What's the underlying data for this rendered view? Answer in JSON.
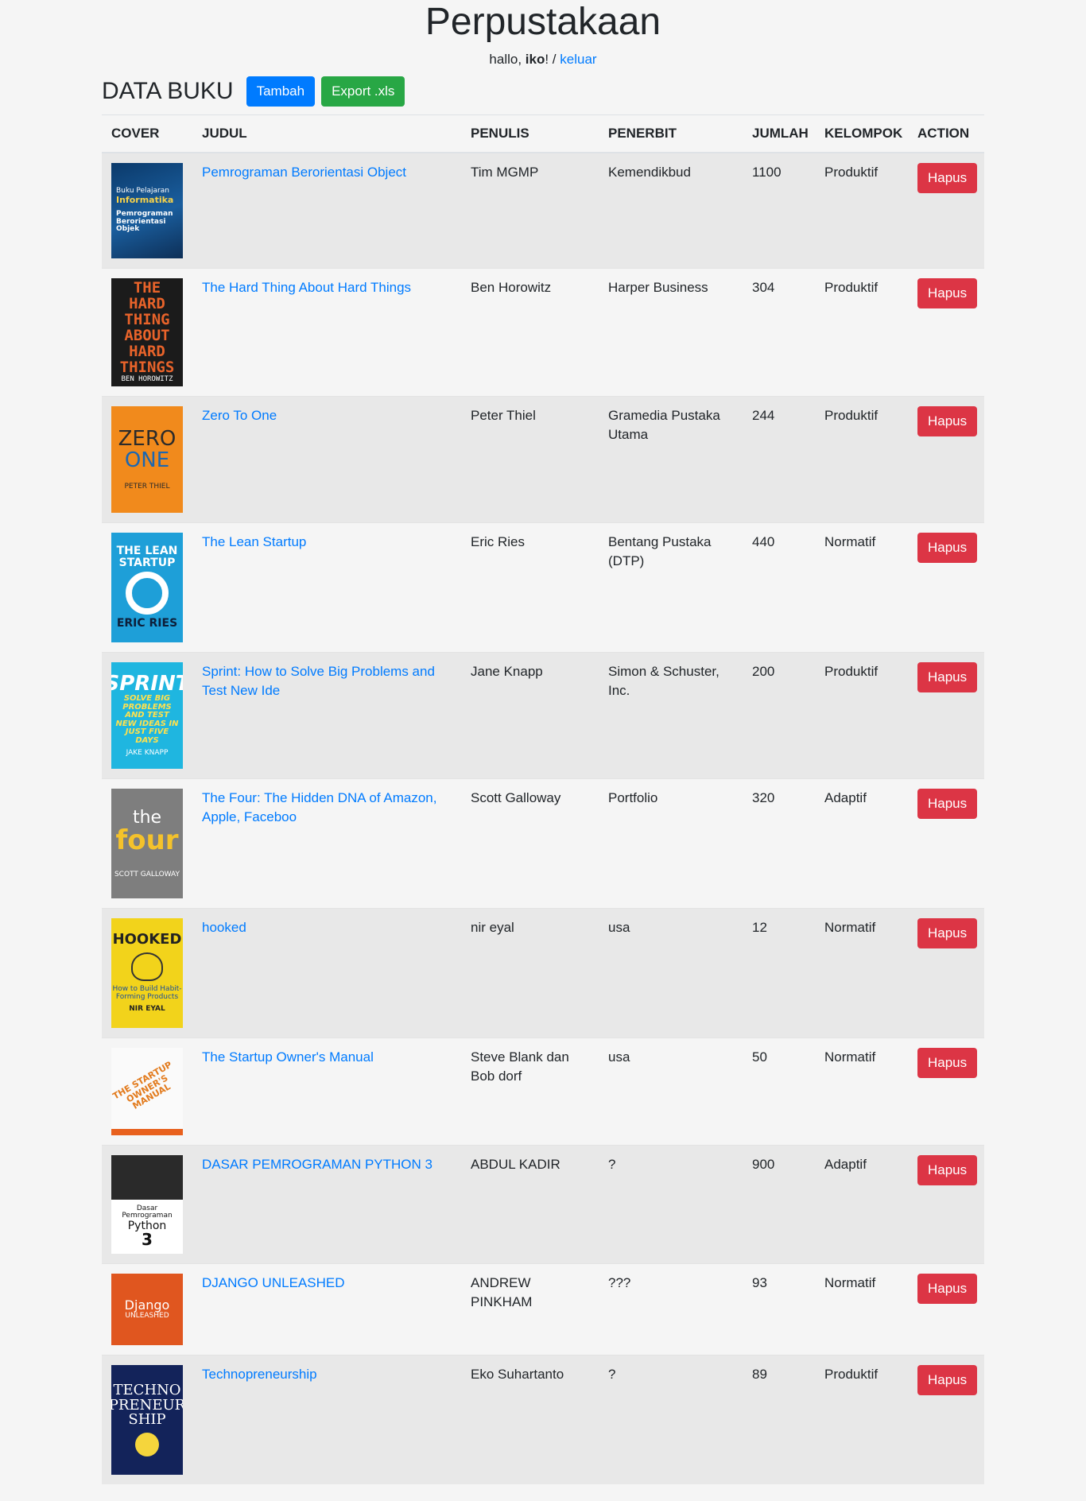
{
  "app": {
    "title": "Perpustakaan",
    "greeting_prefix": "hallo, ",
    "username": "iko",
    "greeting_sep": "! / ",
    "logout_link": "keluar"
  },
  "section": {
    "title": "DATA BUKU",
    "add_button": "Tambah",
    "export_button": "Export .xls"
  },
  "table": {
    "headers": {
      "cover": "COVER",
      "judul": "JUDUL",
      "penulis": "PENULIS",
      "penerbit": "PENERBIT",
      "jumlah": "JUMLAH",
      "kelompok": "KELOMPOK",
      "action": "ACTION"
    },
    "delete_label": "Hapus",
    "rows": [
      {
        "judul": "Pemrograman Berorientasi Object",
        "penulis": "Tim MGMP",
        "penerbit": "Kemendikbud",
        "jumlah": "1100",
        "kelompok": "Produktif"
      },
      {
        "judul": "The Hard Thing About Hard Things",
        "penulis": "Ben Horowitz",
        "penerbit": "Harper Business",
        "jumlah": "304",
        "kelompok": "Produktif"
      },
      {
        "judul": "Zero To One",
        "penulis": "Peter Thiel",
        "penerbit": "Gramedia Pustaka Utama",
        "jumlah": "244",
        "kelompok": "Produktif"
      },
      {
        "judul": "The Lean Startup",
        "penulis": "Eric Ries",
        "penerbit": "Bentang Pustaka (DTP)",
        "jumlah": "440",
        "kelompok": "Normatif"
      },
      {
        "judul": "Sprint: How to Solve Big Problems and Test New Ide",
        "penulis": "Jane Knapp",
        "penerbit": "Simon & Schuster, Inc.",
        "jumlah": "200",
        "kelompok": "Produktif"
      },
      {
        "judul": "The Four: The Hidden DNA of Amazon, Apple, Faceboo",
        "penulis": "Scott Galloway",
        "penerbit": "Portfolio",
        "jumlah": "320",
        "kelompok": "Adaptif"
      },
      {
        "judul": "hooked",
        "penulis": "nir eyal",
        "penerbit": "usa",
        "jumlah": "12",
        "kelompok": "Normatif"
      },
      {
        "judul": "The Startup Owner's Manual",
        "penulis": "Steve Blank dan Bob dorf",
        "penerbit": "usa",
        "jumlah": "50",
        "kelompok": "Normatif"
      },
      {
        "judul": "DASAR PEMROGRAMAN PYTHON 3",
        "penulis": "ABDUL KADIR",
        "penerbit": "?",
        "jumlah": "900",
        "kelompok": "Adaptif"
      },
      {
        "judul": "DJANGO UNLEASHED",
        "penulis": "ANDREW PINKHAM",
        "penerbit": "???",
        "jumlah": "93",
        "kelompok": "Normatif"
      },
      {
        "judul": "Technopreneurship",
        "penulis": "Eko Suhartanto",
        "penerbit": "?",
        "jumlah": "89",
        "kelompok": "Produktif"
      }
    ]
  },
  "covers": {
    "c1": {
      "top": "Buku Pelajaran",
      "subject": "Informatika",
      "title": "Pemrograman Berorientasi Objek"
    },
    "c2": {
      "line1": "THE",
      "line2": "HARD",
      "line3": "THING",
      "line4": "ABOUT",
      "line5": "HARD",
      "line6": "THINGS",
      "author": "BEN HOROWITZ"
    },
    "c3": {
      "word1": "ZERO",
      "word2": "ONE",
      "author": "PETER THIEL"
    },
    "c4": {
      "line1": "THE LEAN",
      "line2": "STARTUP",
      "author": "ERIC RIES"
    },
    "c5": {
      "word": "SPRINT",
      "sub": "SOLVE BIG PROBLEMS AND TEST NEW IDEAS IN JUST FIVE DAYS",
      "author": "JAKE KNAPP"
    },
    "c6": {
      "the": "the",
      "four": "four",
      "author": "SCOTT GALLOWAY"
    },
    "c7": {
      "word": "HOOKED",
      "sub": "How to Build Habit-Forming Products",
      "author": "NIR EYAL"
    },
    "c8": {
      "title": "THE STARTUP OWNER'S MANUAL"
    },
    "c9": {
      "line1": "Dasar Pemrograman",
      "line2": "Python",
      "line3": "3"
    },
    "c10": {
      "word": "Django",
      "sub": "UNLEASHED"
    },
    "c11": {
      "line1": "TECHNO",
      "line2": "PRENEUR",
      "line3": "SHIP"
    }
  },
  "colors": {
    "primary": "#007bff",
    "success": "#28a745",
    "danger": "#dc3545",
    "background": "#f5f5f5",
    "striped_row": "#e8e8e8"
  }
}
